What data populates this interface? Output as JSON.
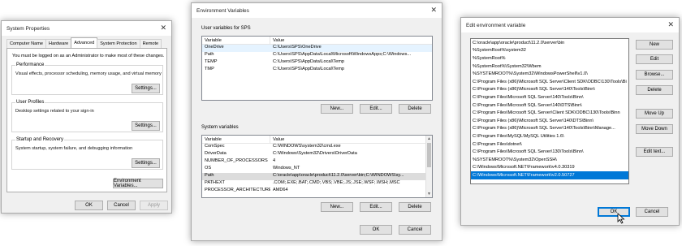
{
  "system_properties": {
    "title": "System Properties",
    "close_glyph": "✕",
    "tabs": [
      "Computer Name",
      "Hardware",
      "Advanced",
      "System Protection",
      "Remote"
    ],
    "active_tab": "Advanced",
    "admin_note": "You must be logged on as an Administrator to make most of these changes.",
    "performance": {
      "label": "Performance",
      "desc": "Visual effects, processor scheduling, memory usage, and virtual memory",
      "button": "Settings..."
    },
    "user_profiles": {
      "label": "User Profiles",
      "desc": "Desktop settings related to your sign-in",
      "button": "Settings..."
    },
    "startup_recovery": {
      "label": "Startup and Recovery",
      "desc": "System startup, system failure, and debugging information",
      "button": "Settings..."
    },
    "env_button": "Environment Variables...",
    "ok": "OK",
    "cancel": "Cancel",
    "apply": "Apply"
  },
  "environment_variables": {
    "title": "Environment Variables",
    "close_glyph": "✕",
    "user_section": "User variables for SPS",
    "col_variable": "Variable",
    "col_value": "Value",
    "user_vars": [
      {
        "name": "OneDrive",
        "value": "C:\\Users\\SPS\\OneDrive"
      },
      {
        "name": "Path",
        "value": "C:\\Users\\SPS\\AppData\\Local\\Microsoft\\WindowsApps;C:\\Windows..."
      },
      {
        "name": "TEMP",
        "value": "C:\\Users\\SPS\\AppData\\Local\\Temp"
      },
      {
        "name": "TMP",
        "value": "C:\\Users\\SPS\\AppData\\Local\\Temp"
      }
    ],
    "user_buttons": {
      "new": "New...",
      "edit": "Edit...",
      "delete": "Delete"
    },
    "system_section": "System variables",
    "system_vars": [
      {
        "name": "ComSpec",
        "value": "C:\\WINDOWS\\system32\\cmd.exe"
      },
      {
        "name": "DriverData",
        "value": "C:\\Windows\\System32\\Drivers\\DriverData"
      },
      {
        "name": "NUMBER_OF_PROCESSORS",
        "value": "4"
      },
      {
        "name": "OS",
        "value": "Windows_NT"
      },
      {
        "name": "Path",
        "value": "C:\\oracle\\app\\oracle\\product\\11.2.0\\server\\bin;C:\\WINDOWS\\sy..."
      },
      {
        "name": "PATHEXT",
        "value": ".COM;.EXE;.BAT;.CMD;.VBS;.VBE;.JS;.JSE;.WSF;.WSH;.MSC"
      },
      {
        "name": "PROCESSOR_ARCHITECTURE",
        "value": "AMD64"
      }
    ],
    "system_buttons": {
      "new": "New...",
      "edit": "Edit...",
      "delete": "Delete"
    },
    "ok": "OK",
    "cancel": "Cancel"
  },
  "edit_env": {
    "title": "Edit environment variable",
    "close_glyph": "✕",
    "entries": [
      "C:\\oracle\\app\\oracle\\product\\11.2.0\\server\\bin",
      "%SystemRoot%\\system32",
      "%SystemRoot%",
      "%SystemRoot%\\System32\\Wbem",
      "%SYSTEMROOT%\\System32\\WindowsPowerShell\\v1.0\\",
      "C:\\Program Files (x86)\\Microsoft SQL Server\\Client SDK\\ODBC\\130\\Tools\\Bi",
      "C:\\Program Files (x86)\\Microsoft SQL Server\\140\\Tools\\Binn\\",
      "C:\\Program Files\\Microsoft SQL Server\\140\\Tools\\Binn\\",
      "C:\\Program Files\\Microsoft SQL Server\\140\\DTS\\Binn\\",
      "C:\\Program Files\\Microsoft SQL Server\\Client SDK\\ODBC\\130\\Tools\\Binn",
      "C:\\Program Files (x86)\\Microsoft SQL Server\\140\\DTS\\Binn\\",
      "C:\\Program Files (x86)\\Microsoft SQL Server\\140\\Tools\\Binn\\Manage...",
      "C:\\Program Files\\MySQL\\MySQL Utilities 1.6\\",
      "C:\\Program Files\\dotnet\\",
      "C:\\Program Files\\Microsoft SQL Server\\130\\Tools\\Binn\\",
      "%SYSTEMROOT%\\System32\\OpenSSH\\",
      "C:\\Windows\\Microsoft.NET\\Framework\\v4.0.30319",
      "C:\\Windows\\Microsoft.NET\\Framework\\v2.0.50727"
    ],
    "selected_index": 17,
    "buttons": {
      "new": "New",
      "edit": "Edit",
      "browse": "Browse...",
      "delete": "Delete",
      "move_up": "Move Up",
      "move_down": "Move Down",
      "edit_text": "Edit text..."
    },
    "ok": "OK",
    "cancel": "Cancel"
  }
}
